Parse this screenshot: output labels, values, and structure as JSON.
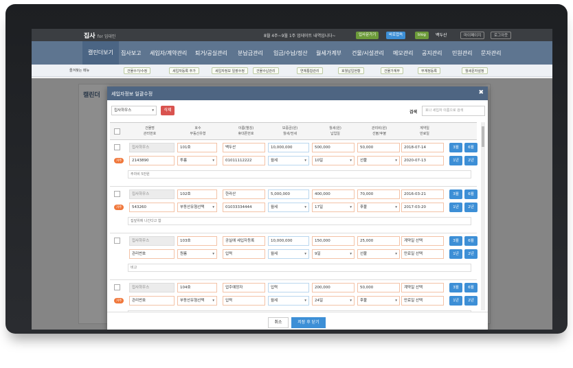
{
  "app": {
    "logo": "집사",
    "logo_sub": "for 임대인",
    "notice": "8월 4주~9월 1주 업데이트 내역입니다~",
    "user": "백두산",
    "buttons": [
      "입사문가기",
      "바로접속",
      "blog",
      "마이페이지",
      "로그아웃"
    ]
  },
  "nav": [
    "캘린더보기",
    "집사보고",
    "세입자/계약관리",
    "퇴거/공실관리",
    "분납금관리",
    "입금/수납/정산",
    "월세가계부",
    "건물/시설관리",
    "메모관리",
    "공지관리",
    "민원관리",
    "문자관리"
  ],
  "subnav": {
    "label": "즐겨찾는 메뉴",
    "items": [
      "건물수가/수정",
      "세입자등록 추가",
      "세입자정보 일괄수정",
      "건물수납관리",
      "연체통합관리",
      "호월납입현황",
      "건물가계부",
      "부계정등록",
      "월세문자설정"
    ]
  },
  "page": {
    "title": "캘린더"
  },
  "modal": {
    "title": "세입자정보 일괄수정",
    "close": "✖",
    "building_select": "집사하우스",
    "delete": "삭제",
    "search_label": "검색",
    "search_placeholder": "호나 세입자 이름으로 검색",
    "cancel": "취소",
    "save": "저장 후 닫기"
  },
  "headers": [
    [
      "건물명",
      "관리번호"
    ],
    [
      "호수",
      "부동산유형"
    ],
    [
      "이름(별칭)",
      "휴대폰번호"
    ],
    [
      "보증금(원)",
      "월세/전세"
    ],
    [
      "월세(원)",
      "납입일"
    ],
    [
      "관리비(원)",
      "선불/후불"
    ],
    [
      "계약일",
      "만료일"
    ]
  ],
  "period_buttons": [
    "3월",
    "6월",
    "1년",
    "2년"
  ],
  "rows": [
    {
      "tag": "거주",
      "building": "집사하우스",
      "code": "2143890",
      "unit": "101호",
      "type": "투룸",
      "name": "백두산",
      "phone": "01011112222",
      "deposit": "10,000,000",
      "rent_type": "월세",
      "rent": "500,000",
      "payday": "10일",
      "fee": "50,000",
      "fee_type": "선불",
      "start": "2018-07-14",
      "end": "2020-07-13",
      "memo": "주차비 5만원"
    },
    {
      "tag": "거주",
      "building": "집사하우스",
      "code": "543260",
      "unit": "102호",
      "type": "부동산유형선택",
      "name": "한라산",
      "phone": "01033334444",
      "deposit": "5,000,000",
      "rent_type": "월세",
      "rent": "400,000",
      "payday": "17일",
      "fee": "70,000",
      "fee_type": "후불",
      "start": "2016-03-21",
      "end": "2017-03-20",
      "memo": "집앞위에 나간다고 함"
    },
    {
      "tag": "",
      "building": "집사하우스",
      "code": "관리번호",
      "unit": "103호",
      "type": "원룸",
      "name": "공실에 세입자등록",
      "phone": "입력",
      "deposit": "10,000,000",
      "rent_type": "월세",
      "rent": "150,000",
      "payday": "9일",
      "fee": "25,000",
      "fee_type": "선불",
      "start": "계약일 선택",
      "end": "만료일 선택",
      "memo": "비고"
    },
    {
      "tag": "거주",
      "building": "집사하우스",
      "code": "관리번호",
      "unit": "104호",
      "type": "부동산유형선택",
      "name": "업주예정자",
      "phone": "입력",
      "deposit": "입력",
      "rent_type": "월세",
      "rent": "200,000",
      "payday": "24일",
      "fee": "50,000",
      "fee_type": "후불",
      "start": "계약일 선택",
      "end": "만료일 선택",
      "memo": ""
    }
  ]
}
